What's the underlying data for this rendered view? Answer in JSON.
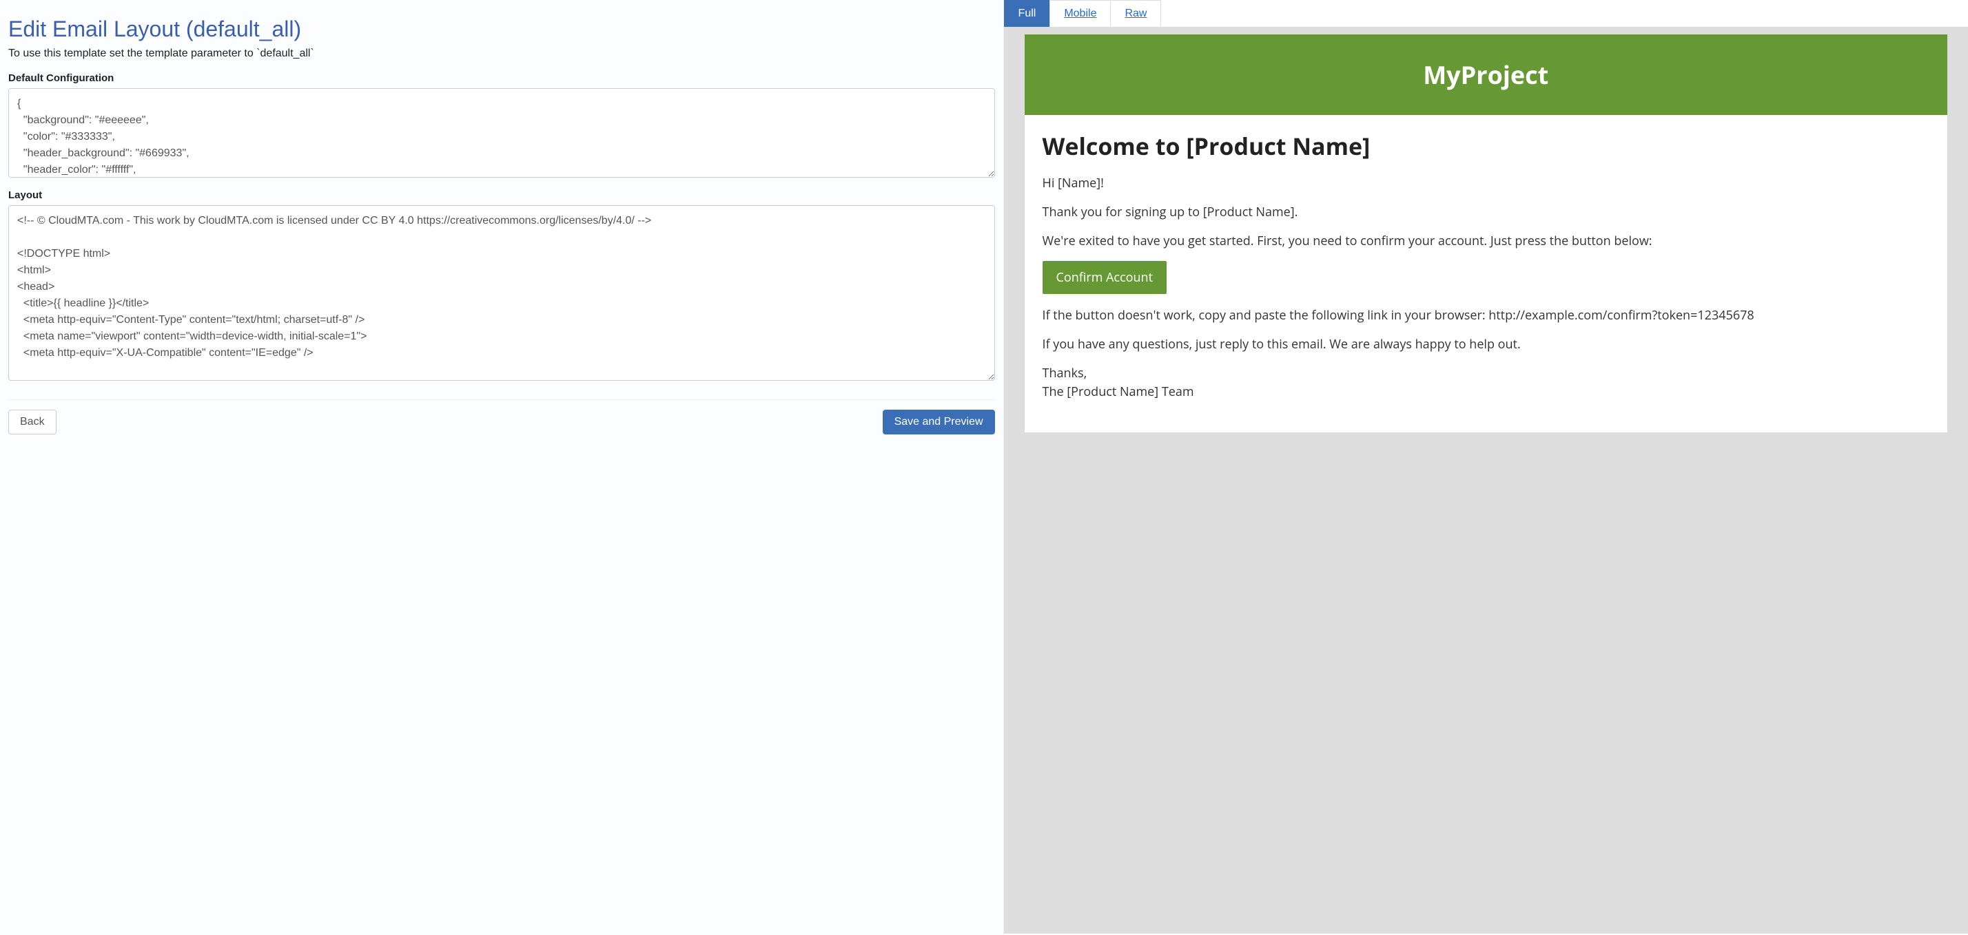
{
  "page": {
    "title": "Edit Email Layout (default_all)",
    "subtitle": "To use this template set the template parameter to `default_all`"
  },
  "form": {
    "config_label": "Default Configuration",
    "config_value": "{\n  \"background\": \"#eeeeee\",\n  \"color\": \"#333333\",\n  \"header_background\": \"#669933\",\n  \"header_color\": \"#ffffff\",",
    "layout_label": "Layout",
    "layout_value": "<!-- © CloudMTA.com - This work by CloudMTA.com is licensed under CC BY 4.0 https://creativecommons.org/licenses/by/4.0/ -->\n\n<!DOCTYPE html>\n<html>\n<head>\n  <title>{{ headline }}</title>\n  <meta http-equiv=\"Content-Type\" content=\"text/html; charset=utf-8\" />\n  <meta name=\"viewport\" content=\"width=device-width, initial-scale=1\">\n  <meta http-equiv=\"X-UA-Compatible\" content=\"IE=edge\" />",
    "back_label": "Back",
    "save_label": "Save and Preview"
  },
  "tabs": {
    "full": "Full",
    "mobile": "Mobile",
    "raw": "Raw"
  },
  "preview": {
    "header": "MyProject",
    "welcome": "Welcome to [Product Name]",
    "greeting": "Hi [Name]!",
    "thanks_signup": "Thank you for signing up to [Product Name].",
    "excited": "We're exited to have you get started. First, you need to confirm your account. Just press the button below:",
    "confirm_button": "Confirm Account",
    "fallback": "If the button doesn't work, copy and paste the following link in your browser: http://example.com/confirm?token=12345678",
    "questions": "If you have any questions, just reply to this email. We are always happy to help out.",
    "signoff1": "Thanks,",
    "signoff2": "The [Product Name] Team"
  }
}
